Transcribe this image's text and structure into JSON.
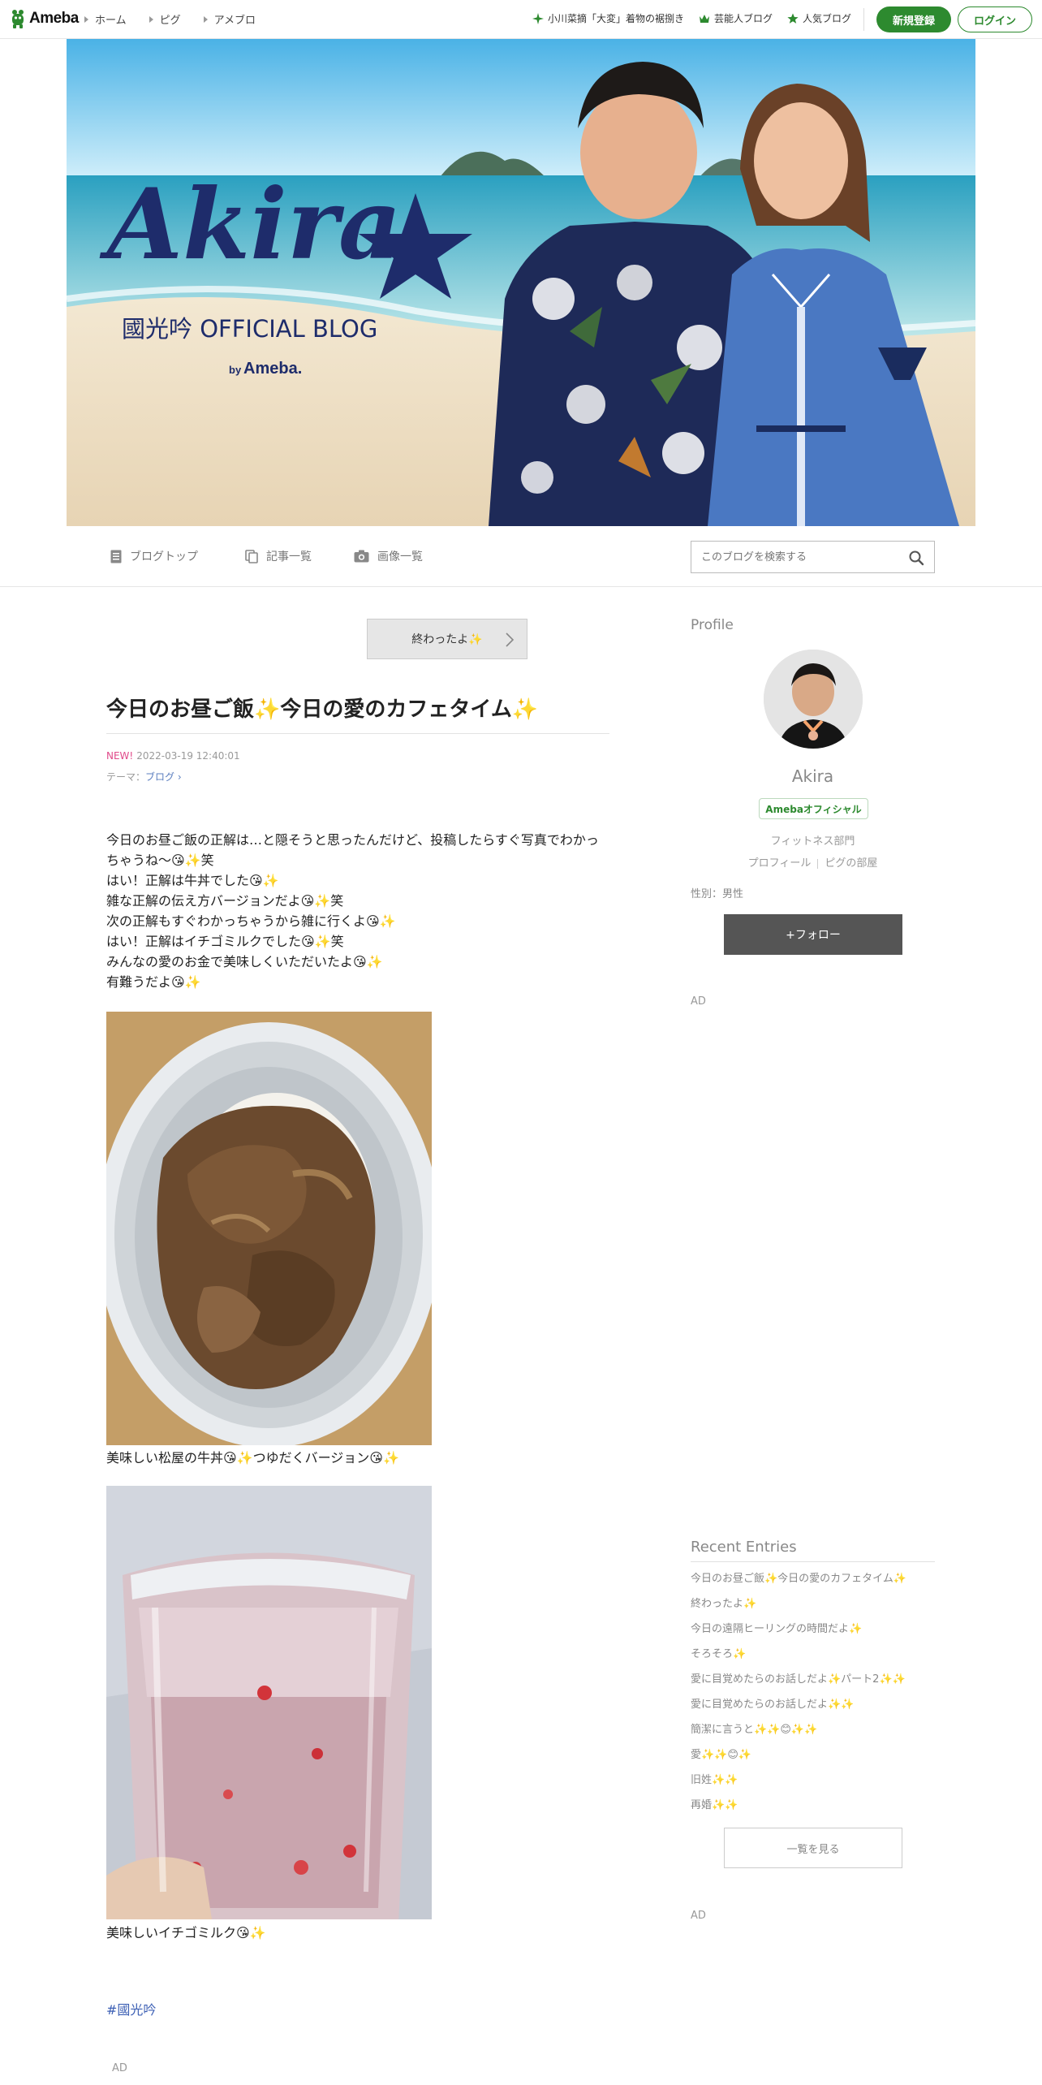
{
  "topbar": {
    "logo_text": "Ameba",
    "nav": [
      "ホーム",
      "ピグ",
      "アメブロ"
    ],
    "links": [
      "小川菜摘「大変」着物の裾捌き",
      "芸能人ブログ",
      "人気ブログ"
    ],
    "signup_label": "新規登録",
    "login_label": "ログイン"
  },
  "banner": {
    "title_script": "Akira",
    "subtitle": "國光吟 OFFICIAL BLOG",
    "by": "by",
    "by_brand": "Ameba."
  },
  "blognav": {
    "items": [
      "ブログトップ",
      "記事一覧",
      "画像一覧"
    ],
    "search_placeholder": "このブログを検索する"
  },
  "article": {
    "next_label": "終わったよ✨",
    "title": "今日のお昼ご飯✨今日の愛のカフェタイム✨",
    "new_badge": "NEW!",
    "date": "2022-03-19 12:40:01",
    "theme_prefix": "テーマ：",
    "theme": "ブログ",
    "body_lines": [
      "今日のお昼ご飯の正解は…と隠そうと思ったんだけど、投稿したらすぐ写真でわかっちゃうね〜😘✨笑",
      "はい！正解は牛丼でした😘✨",
      "雑な正解の伝え方バージョンだよ😘✨笑",
      "次の正解もすぐわかっちゃうから雑に行くよ😘✨",
      "はい！正解はイチゴミルクでした😘✨笑",
      "みんなの愛のお金で美味しくいただいたよ😘✨",
      "有難うだよ😘✨"
    ],
    "caption1": "美味しい松屋の牛丼😘✨つゆだくバージョン😘✨",
    "caption2": "美味しいイチゴミルク😘✨",
    "hashtag": "#國光吟",
    "ad": "AD"
  },
  "sidebar": {
    "profile_heading": "Profile",
    "name": "Akira",
    "official_badge": "Amebaオフィシャル",
    "category": "フィットネス部門",
    "profile_link": "プロフィール",
    "pig_link": "ピグの部屋",
    "gender": "性別：男性",
    "follow_label": "+フォロー",
    "ad1": "AD",
    "recent_heading": "Recent Entries",
    "recent": [
      "今日のお昼ご飯✨今日の愛のカフェタイム✨",
      "終わったよ✨",
      "今日の遠隔ヒーリングの時間だよ✨",
      "そろそろ✨",
      "愛に目覚めたらのお話しだよ✨パート2✨✨",
      "愛に目覚めたらのお話しだよ✨✨",
      "簡潔に言うと✨✨😊✨✨",
      "愛✨✨😊✨",
      "旧姓✨✨",
      "再婚✨✨"
    ],
    "more_label": "一覧を見る",
    "ad2": "AD"
  },
  "colors": {
    "brand_green": "#2d8a2f",
    "link_blue": "#3c5fb4",
    "new_pink": "#e04a8a",
    "follow_bg": "#555555"
  }
}
